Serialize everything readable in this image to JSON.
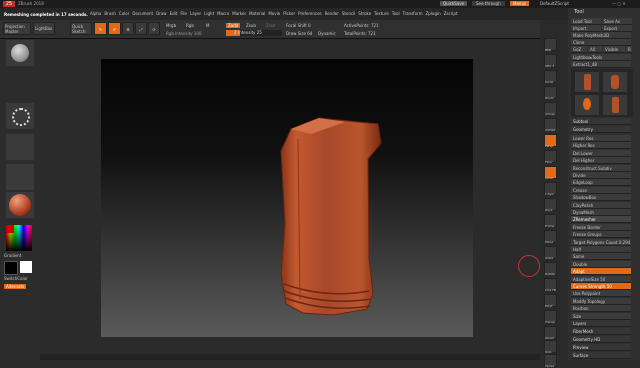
{
  "titlebar": {
    "app": "ZBrush 2018",
    "status": "Remeshing completed in 17 seconds.",
    "menus": [
      "Alpha",
      "Brush",
      "Color",
      "Document",
      "Draw",
      "Edit",
      "File",
      "Layer",
      "Light",
      "Macro",
      "Marker",
      "Material",
      "Movie",
      "Picker",
      "Preferences",
      "Render",
      "Stencil",
      "Stroke",
      "Texture",
      "Tool",
      "Transform",
      "Zplugin",
      "Zscript"
    ],
    "quicksave": "QuickSave",
    "see_through": "See-through",
    "menus_btn": "Menus",
    "default_script": "DefaultZScript"
  },
  "topbar": {
    "projection": "Projection Master",
    "lightbox": "LightBox",
    "quick_sketch": "Quick Sketch",
    "edit": "Edit",
    "draw": "Draw",
    "move": "Move",
    "scale": "Scale",
    "rotate": "Rotate",
    "mrgb": "Mrgb",
    "rgb": "Rgb",
    "m": "M",
    "zadd": "Zadd",
    "zsub": "Zsub",
    "zcut": "Zcut",
    "z_intensity": "Z Intensity 25",
    "focal_shift": "Focal Shift 0",
    "draw_size": "Draw Size 64",
    "dynamic": "Dynamic",
    "active_points": "ActivePoints: 721",
    "total_points": "TotalPoints: 721",
    "rgb_intensity": "Rgb Intensity 100"
  },
  "left_panel": {
    "gradient": "Gradient",
    "switch_color": "SwitchColor",
    "alternate": "Alternate"
  },
  "right_shelf": [
    "BPR",
    "SPix 3",
    "Scroll",
    "Zoom",
    "Actual",
    "AAHalf",
    "Persp",
    "Floor",
    "Local",
    "L.Sym",
    "Gxyz",
    "Frame",
    "Move",
    "Scale",
    "Rotate",
    "Line Fill",
    "PolyF",
    "Transp",
    "Ghost",
    "Solo",
    "Xpose"
  ],
  "tool_panel": {
    "title": "Tool",
    "load_tool": "Load Tool",
    "save_as": "Save As",
    "import": "Import",
    "export": "Export",
    "clone": "Clone",
    "make_polymesh": "Make PolyMesh3D",
    "goz": "GoZ",
    "all": "All",
    "visible": "Visible",
    "r": "R",
    "lightbox_tools": "Lightbox▸Tools",
    "current_tool": "Extract1_48",
    "subtools": [
      "Extract1_48",
      "Cylinder3D",
      "SimpleBrush",
      "Extract1_48"
    ],
    "sections": [
      "Subtool",
      "Geometry"
    ],
    "geometry_items": [
      "Lower Res",
      "Higher Res",
      "Del Lower",
      "Del Higher",
      "Reconstruct Subdiv",
      "Divide",
      "EdgeLoop",
      "Crease",
      "ShadowBox",
      "ClayPolish",
      "DynaMesh",
      "ZRemesher",
      "Freeze Border",
      "Freeze Groups",
      "Target Polygons Count 0.294",
      "Half",
      "Same",
      "Double",
      "Adapt",
      "AdaptiveSize 50",
      "Curves Strength 50",
      "Use Polypaint",
      "Modify Topology",
      "Position",
      "Size",
      "MeshIntegrity"
    ],
    "bottom_sections": [
      "Layers",
      "FiberMesh",
      "Geometry HD",
      "Preview",
      "Surface"
    ]
  }
}
